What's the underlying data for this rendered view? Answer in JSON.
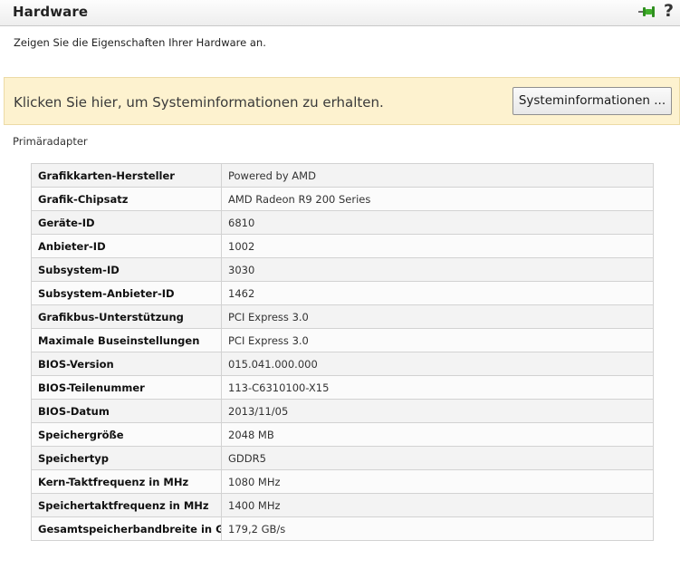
{
  "header": {
    "title": "Hardware",
    "pin_icon": "pin-icon",
    "help_icon": "help-icon",
    "help_glyph": "?"
  },
  "subtitle": "Zeigen Sie die Eigenschaften Ihrer Hardware an.",
  "banner": {
    "text": "Klicken Sie hier, um Systeminformationen zu erhalten.",
    "button_label": "Systeminformationen ..."
  },
  "section_label": "Primäradapter",
  "properties": [
    {
      "name": "Grafikkarten-Hersteller",
      "value": "Powered by AMD"
    },
    {
      "name": "Grafik-Chipsatz",
      "value": "AMD Radeon R9 200 Series"
    },
    {
      "name": "Geräte-ID",
      "value": "6810"
    },
    {
      "name": "Anbieter-ID",
      "value": "1002"
    },
    {
      "name": "Subsystem-ID",
      "value": "3030"
    },
    {
      "name": "Subsystem-Anbieter-ID",
      "value": "1462"
    },
    {
      "name": "Grafikbus-Unterstützung",
      "value": "PCI Express 3.0"
    },
    {
      "name": "Maximale Buseinstellungen",
      "value": "PCI Express 3.0"
    },
    {
      "name": "BIOS-Version",
      "value": "015.041.000.000"
    },
    {
      "name": "BIOS-Teilenummer",
      "value": "113-C6310100-X15"
    },
    {
      "name": "BIOS-Datum",
      "value": "2013/11/05"
    },
    {
      "name": "Speichergröße",
      "value": "2048 MB"
    },
    {
      "name": "Speichertyp",
      "value": "GDDR5"
    },
    {
      "name": "Kern-Taktfrequenz in MHz",
      "value": "1080 MHz"
    },
    {
      "name": "Speichertaktfrequenz in MHz",
      "value": "1400 MHz"
    },
    {
      "name": "Gesamtspeicherbandbreite in GB/s",
      "value": "179,2 GB/s"
    }
  ],
  "colors": {
    "banner_background": "#fdf2cf",
    "pin_green": "#3fae2a"
  }
}
